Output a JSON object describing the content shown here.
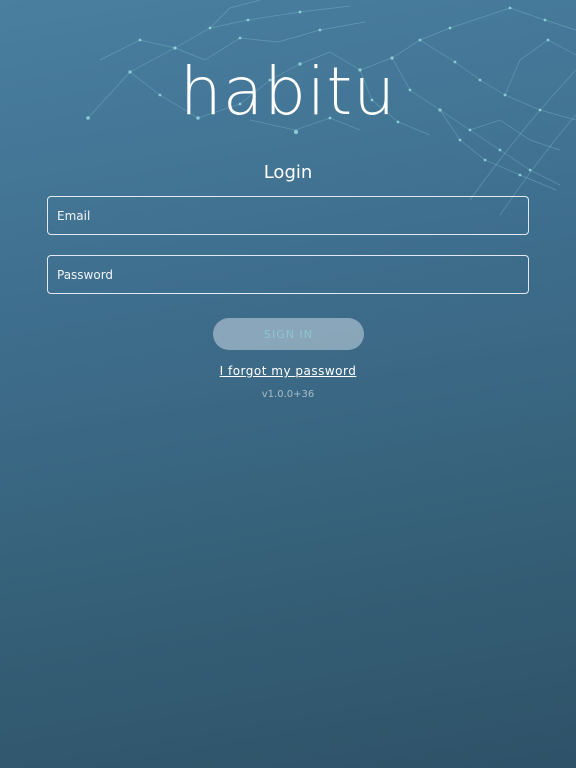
{
  "logo": {
    "text": "habitu"
  },
  "login": {
    "title": "Login",
    "email_placeholder": "Email",
    "password_placeholder": "Password",
    "signin_label": "SIGN IN",
    "forgot_label": "I forgot my password",
    "version": "v1.0.0+36"
  },
  "colors": {
    "background_top": "#4a7f9f",
    "background_bottom": "#2e5268",
    "network_lines": "#8fd7e0",
    "button_bg": "#c8d7e1",
    "button_text": "#8fc6cd"
  }
}
